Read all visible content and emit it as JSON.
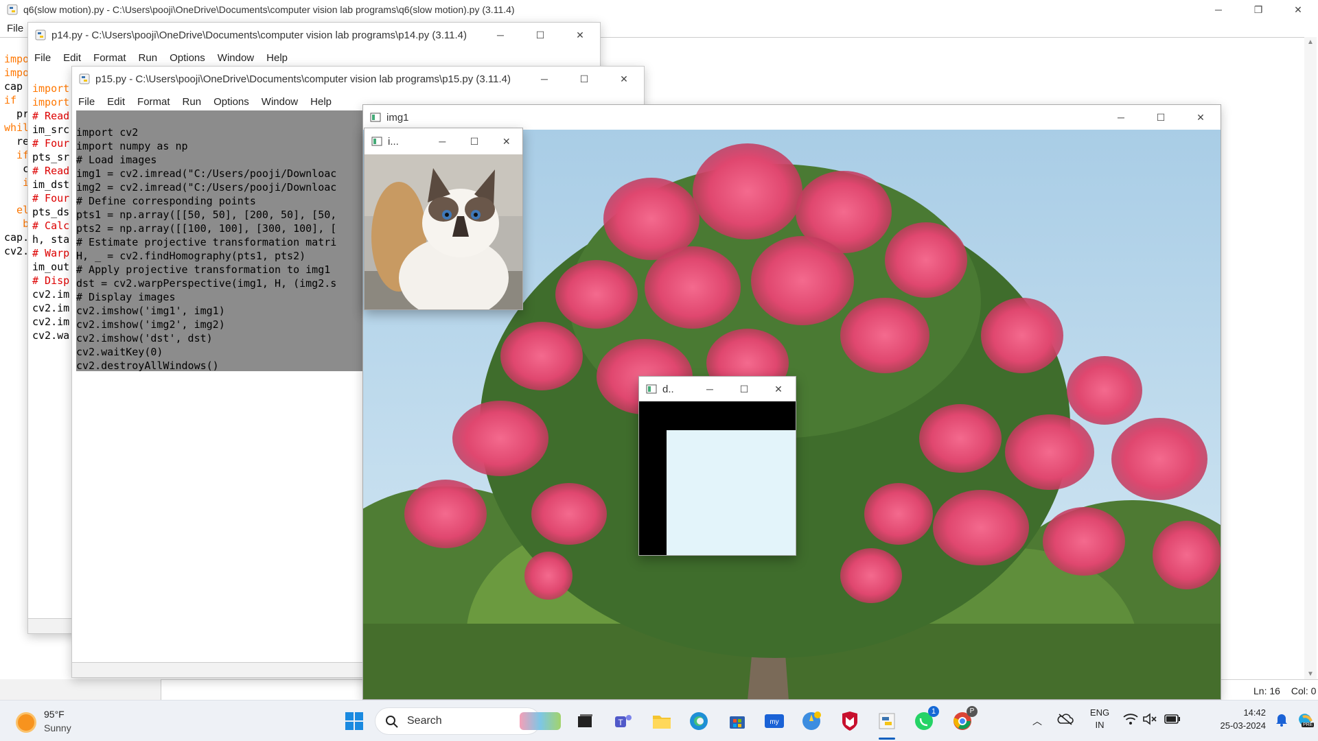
{
  "windows": {
    "q6": {
      "title": "q6(slow motion).py - C:\\Users\\pooji\\OneDrive\\Documents\\computer vision lab programs\\q6(slow motion).py (3.11.4)",
      "menu": [
        "File"
      ],
      "code_lines": [
        "impo",
        "impo",
        "cap",
        "if",
        "  pri",
        "whil",
        "  ret",
        "  if",
        "   cv",
        "   i",
        "    b",
        "  els",
        "   br",
        "cap.",
        "cv2."
      ],
      "status": {
        "line": "Ln: 16",
        "col": "Col: 0"
      }
    },
    "p14": {
      "title": "p14.py - C:\\Users\\pooji\\OneDrive\\Documents\\computer vision lab programs\\p14.py (3.11.4)",
      "menu": [
        "File",
        "Edit",
        "Format",
        "Run",
        "Options",
        "Window",
        "Help"
      ],
      "code_lines": [
        "import",
        "import",
        "# Read",
        "im_src",
        "# Four",
        "pts_sr",
        "# Read",
        "im_dst",
        "# Four",
        "pts_ds",
        "# Calc",
        "h, sta",
        "# Warp",
        "im_out",
        "# Disp",
        "cv2.im",
        "cv2.im",
        "cv2.im",
        "cv2.wa"
      ]
    },
    "p15": {
      "title": "p15.py - C:\\Users\\pooji\\OneDrive\\Documents\\computer vision lab programs\\p15.py (3.11.4)",
      "menu": [
        "File",
        "Edit",
        "Format",
        "Run",
        "Options",
        "Window",
        "Help"
      ],
      "code_lines": [
        "import cv2",
        "import numpy as np",
        "# Load images",
        "img1 = cv2.imread(\"C:/Users/pooji/Downloac",
        "img2 = cv2.imread(\"C:/Users/pooji/Downloac",
        "# Define corresponding points",
        "pts1 = np.array([[50, 50], [200, 50], [50,",
        "pts2 = np.array([[100, 100], [300, 100], [",
        "# Estimate projective transformation matri",
        "H, _ = cv2.findHomography(pts1, pts2)",
        "# Apply projective transformation to img1",
        "dst = cv2.warpPerspective(img1, H, (img2.s",
        "# Display images",
        "cv2.imshow('img1', img1)",
        "cv2.imshow('img2', img2)",
        "cv2.imshow('dst', dst)",
        "cv2.waitKey(0)",
        "cv2.destroyAllWindows()"
      ]
    },
    "img1": {
      "title": "img1"
    },
    "img2": {
      "title": "i..."
    },
    "dst": {
      "title": "d.."
    }
  },
  "taskbar": {
    "weather": {
      "temp": "95°F",
      "desc": "Sunny"
    },
    "search_label": "Search",
    "language": {
      "line1": "ENG",
      "line2": "IN"
    },
    "clock": {
      "time": "14:42",
      "date": "25-03-2024"
    },
    "whatsapp_badge": "1",
    "chrome_profile": "P",
    "copilot_badge": "PRE",
    "icons": [
      "windows-start-icon",
      "search-icon",
      "task-view-icon",
      "teams-icon",
      "file-explorer-icon",
      "edge-icon",
      "microsoft-store-icon",
      "myasus-icon",
      "python-idle-icon",
      "mcafee-icon",
      "python-idle-active-icon",
      "whatsapp-icon",
      "chrome-icon"
    ]
  }
}
